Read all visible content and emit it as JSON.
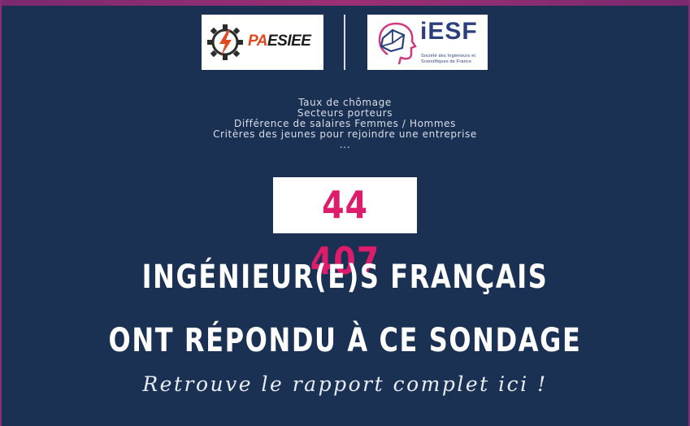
{
  "partners": {
    "pa_esiee": {
      "word_accent": "PA",
      "word_rest": "ESIEE"
    },
    "iesf": {
      "word": "iESF",
      "subtitle_line1": "Société des Ingénieurs et",
      "subtitle_line2": "Scientifiques de France"
    }
  },
  "topics": [
    "Taux de chômage",
    "Secteurs porteurs",
    "Différence de salaires Femmes / Hommes",
    "Critères des jeunes pour rejoindre une entreprise",
    "..."
  ],
  "respondents": {
    "count": "44 407"
  },
  "headline": {
    "line1": "INGÉNIEUR(E)S FRANÇAIS",
    "line2": "ONT RÉPONDU À CE SONDAGE"
  },
  "cta": {
    "label": "Retrouve le rapport complet ici !"
  },
  "colors": {
    "background": "#1b3153",
    "accent": "#dd1c6b",
    "strip": "#9c2f75",
    "pa_orange": "#e2481f",
    "iesf_blue": "#2a3f7d"
  }
}
